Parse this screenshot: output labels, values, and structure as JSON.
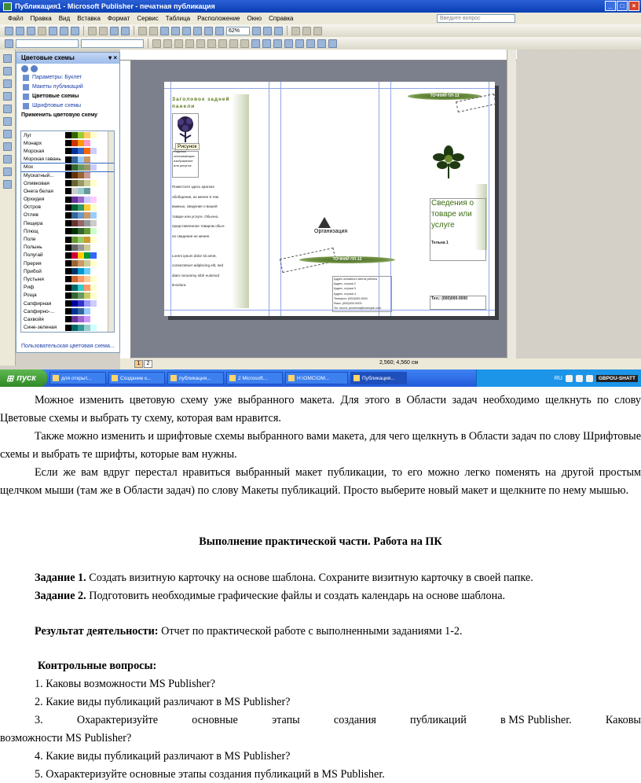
{
  "window": {
    "title": "Публикация1 - Microsoft Publisher - печатная публикация",
    "menu": [
      "Файл",
      "Правка",
      "Вид",
      "Вставка",
      "Формат",
      "Сервис",
      "Таблица",
      "Расположение",
      "Окно",
      "Справка"
    ],
    "help_placeholder": "Введите вопрос",
    "zoom": "62%"
  },
  "taskpane": {
    "title": "Цветовые схемы",
    "links": [
      "Параметры: Буклет",
      "Макеты публикаций",
      "Цветовые схемы",
      "Шрифтовые схемы"
    ],
    "apply_label": "Применить цветовую схему",
    "custom_link": "Пользовательская цветовая схема...",
    "schemes": [
      {
        "name": "Луг",
        "colors": [
          "#000000",
          "#336600",
          "#99cc33",
          "#ffcc66",
          "#ffffcc"
        ]
      },
      {
        "name": "Монарх",
        "colors": [
          "#000000",
          "#cc3300",
          "#ff9900",
          "#ff99cc",
          "#ffffff"
        ]
      },
      {
        "name": "Морская",
        "colors": [
          "#000000",
          "#003399",
          "#3366cc",
          "#ff6600",
          "#ccccff"
        ]
      },
      {
        "name": "Морская гавань",
        "colors": [
          "#000000",
          "#336699",
          "#99ccff",
          "#cc9966",
          "#ffffff"
        ]
      },
      {
        "name": "Мох",
        "colors": [
          "#000000",
          "#336633",
          "#669966",
          "#999966",
          "#ccccff"
        ]
      },
      {
        "name": "Мускатный...",
        "colors": [
          "#000000",
          "#663300",
          "#996633",
          "#cc9999",
          "#ffffff"
        ]
      },
      {
        "name": "Оливковая",
        "colors": [
          "#000000",
          "#666633",
          "#999966",
          "#cccc99",
          "#ffffcc"
        ]
      },
      {
        "name": "Онега белая",
        "colors": [
          "#000000",
          "#cccccc",
          "#99cccc",
          "#669999",
          "#ffffff"
        ]
      },
      {
        "name": "Орхидея",
        "colors": [
          "#000000",
          "#663399",
          "#9966cc",
          "#ccccff",
          "#ffccff"
        ]
      },
      {
        "name": "Остров",
        "colors": [
          "#000000",
          "#006633",
          "#339966",
          "#ffcc33",
          "#ffffcc"
        ]
      },
      {
        "name": "Отлив",
        "colors": [
          "#000000",
          "#336699",
          "#6699cc",
          "#cc9966",
          "#99ccff"
        ]
      },
      {
        "name": "Пещера",
        "colors": [
          "#000000",
          "#663333",
          "#996666",
          "#999999",
          "#cccccc"
        ]
      },
      {
        "name": "Плющ",
        "colors": [
          "#000000",
          "#003300",
          "#336633",
          "#669933",
          "#ccffcc"
        ]
      },
      {
        "name": "Поле",
        "colors": [
          "#000000",
          "#669933",
          "#99cc66",
          "#cc9933",
          "#ffffcc"
        ]
      },
      {
        "name": "Полынь",
        "colors": [
          "#000000",
          "#666666",
          "#999999",
          "#cccc99",
          "#ffffff"
        ]
      },
      {
        "name": "Полугай",
        "colors": [
          "#000000",
          "#cc0033",
          "#ffcc00",
          "#009933",
          "#3366ff"
        ]
      },
      {
        "name": "Прерия",
        "colors": [
          "#000000",
          "#996633",
          "#cc9966",
          "#cccc99",
          "#ffffcc"
        ]
      },
      {
        "name": "Прибой",
        "colors": [
          "#000000",
          "#003366",
          "#0099cc",
          "#66ccff",
          "#ffffff"
        ]
      },
      {
        "name": "Пустыня",
        "colors": [
          "#000000",
          "#cc6633",
          "#ff9966",
          "#ffcc99",
          "#ffffcc"
        ]
      },
      {
        "name": "Риф",
        "colors": [
          "#000000",
          "#006666",
          "#33cccc",
          "#ff9966",
          "#ffffcc"
        ]
      },
      {
        "name": "Роща",
        "colors": [
          "#000000",
          "#336633",
          "#669966",
          "#cccc66",
          "#ffffcc"
        ]
      },
      {
        "name": "Сапфирная",
        "colors": [
          "#000000",
          "#000099",
          "#3333cc",
          "#9999ff",
          "#ccccff"
        ]
      },
      {
        "name": "Сапфирно-...",
        "colors": [
          "#000000",
          "#003399",
          "#336699",
          "#99ccff",
          "#ffffff"
        ]
      },
      {
        "name": "Сахвойя",
        "colors": [
          "#000000",
          "#663399",
          "#9966cc",
          "#cc99ff",
          "#ffffff"
        ]
      },
      {
        "name": "Сине-зеленая",
        "colors": [
          "#000000",
          "#006666",
          "#339999",
          "#99cccc",
          "#ccffff"
        ]
      }
    ],
    "selected_scheme": "Мох"
  },
  "publication": {
    "left_title": "Заголовок задней панели",
    "picture_tag": "Рисунок",
    "caption_small": [
      "Подпись",
      "описывающая",
      "изображение",
      "или рисунок"
    ],
    "body_lines": [
      "Поместите здесь краткое",
      "обобщение, из менее 5 тем",
      "важных, сведения о вашей",
      "товаре или услуге. Обычно,",
      "представленное товаром обыч-",
      "но сведения не менее.",
      "",
      "Lorem ipsum dolor sit amet,",
      "consectetuer adipiscing elit, sed",
      "diam nonummy nibh euismod",
      "tincidunt."
    ],
    "org": "Организация",
    "banner_text": "ТОЧНИЙ ПЛ-13",
    "address_lines": [
      "Адрес основного места работы",
      "Адрес, строка 2",
      "Адрес, строка 3",
      "Адрес, строка 4",
      "Телефон: (000)000-0000",
      "Факс: (000)000-0000",
      "Эл. почта: proverka@example.com"
    ],
    "info_heading": [
      "Сведения о",
      "товаре или",
      "услуге"
    ],
    "tagline": "Тельна 1",
    "phone_box": "Тел.: (000)000-0000"
  },
  "status": {
    "pages": [
      "1",
      "2"
    ],
    "coords": "2,560; 4,560 см"
  },
  "taskbar": {
    "start": "пуск",
    "tasks": [
      "для открыт...",
      "Создание к...",
      "публикация...",
      "2 Microsoft...",
      "H:\\ОМС\\ОМ...",
      "Публикация..."
    ],
    "lang": "RU",
    "badge": "GBPOU-SHATT"
  },
  "doc": {
    "para1": "Можное изменить цветовую схему уже выбранного макета. Для этого в Области задач необходимо щелкнуть по слову Цветовые схемы и выбрать ту схему, которая вам нравится.",
    "para2": "Также можно изменить и шрифтовые схемы выбранного вами макета, для чего щелкнуть в Области задач по слову Шрифтовые схемы и выбрать те шрифты, которые вам нужны.",
    "para3": "Если же вам вдруг перестал нравиться выбранный макет публикации, то его можно легко поменять на другой простым щелчком мыши (там же в Области задач) по слову Макеты публикаций. Просто выберите новый макет и щелкните по нему мышью.",
    "heading": "Выполнение практической части. Работа на ПК",
    "task1_label": "Задание 1.",
    "task1_text": " Создать визитную карточку на основе шаблона. Сохраните визитную карточку в своей папке.",
    "task2_label": "Задание 2.",
    "task2_text": " Подготовить необходимые графические файлы и создать календарь на основе шаблона.",
    "result_label": "Результат деятельности:",
    "result_text": " Отчет по практической работе с выполненными заданиями 1-2.",
    "questions_label": "Контрольные вопросы:",
    "q1": "1. Каковы возможности MS Publisher?",
    "q2": "2. Какие виды публикаций различают в MS Publisher?",
    "q3_words": [
      "3.",
      "Охарактеризуйте",
      "основные",
      "этапы",
      "создания",
      "публикаций",
      "в MS Publisher.",
      "Каковы"
    ],
    "q3_cont": "возможности MS Publisher?",
    "q4": "4. Какие виды публикаций различают в MS Publisher?",
    "q5": "5. Охарактеризуйте основные этапы создания публикаций в MS Publisher."
  }
}
